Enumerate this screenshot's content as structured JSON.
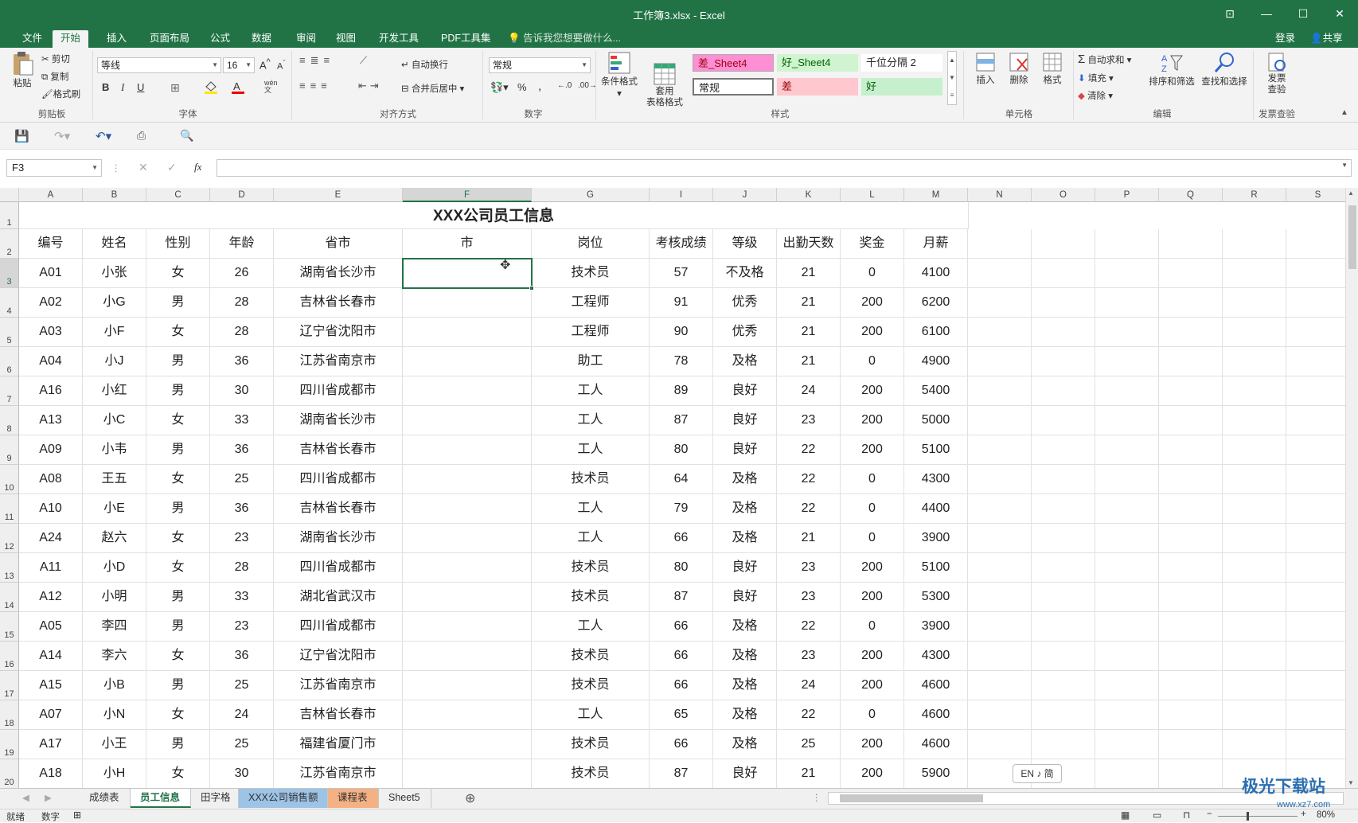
{
  "window": {
    "title": "工作簿3.xlsx - Excel"
  },
  "ribbon_tabs": [
    "文件",
    "开始",
    "插入",
    "页面布局",
    "公式",
    "数据",
    "审阅",
    "视图",
    "开发工具",
    "PDF工具集"
  ],
  "active_tab": "开始",
  "tell_me": "告诉我您想要做什么...",
  "account": {
    "login": "登录",
    "share": "共享"
  },
  "clipboard": {
    "paste": "粘贴",
    "cut": "剪切",
    "copy": "复制",
    "format_painter": "格式刷",
    "label": "剪贴板"
  },
  "font": {
    "name": "等线",
    "size": "16",
    "label": "字体",
    "bold": "B",
    "italic": "I",
    "underline": "U",
    "phonetic": "wén\n文"
  },
  "alignment": {
    "wrap": "自动换行",
    "merge": "合并后居中",
    "label": "对齐方式"
  },
  "number": {
    "format": "常规",
    "label": "数字",
    "percent": "%",
    "comma": ","
  },
  "styles": {
    "conditional": "条件格式",
    "table": "套用\n表格格式",
    "label": "样式",
    "cells": [
      "差_Sheet4",
      "好_Sheet4",
      "千位分隔 2",
      "常规",
      "差",
      "好"
    ],
    "colors": {
      "bad_bg": "#ffc7ce",
      "good_bg": "#c6efce",
      "bad_pink": "#ff8fd5",
      "good_green": "#d0f4d0"
    }
  },
  "cells_group": {
    "insert": "插入",
    "delete": "删除",
    "format": "格式",
    "label": "单元格"
  },
  "editing": {
    "autosum": "自动求和",
    "fill": "填充",
    "clear": "清除",
    "sort": "排序和筛选",
    "find": "查找和选择",
    "label": "编辑"
  },
  "invoice": {
    "check": "发票\n查验",
    "label": "发票查验"
  },
  "namebox": "F3",
  "fx": "fx",
  "columns": [
    "A",
    "B",
    "C",
    "D",
    "E",
    "F",
    "G",
    "I",
    "J",
    "K",
    "L",
    "M",
    "N",
    "O",
    "P",
    "Q",
    "R",
    "S"
  ],
  "row_numbers": [
    "1",
    "2",
    "3",
    "4",
    "5",
    "6",
    "7",
    "8",
    "9",
    "10",
    "11",
    "12",
    "13",
    "14",
    "15",
    "16",
    "17",
    "18",
    "19",
    "20"
  ],
  "sheet_title": "XXX公司员工信息",
  "headers": [
    "编号",
    "姓名",
    "性别",
    "年龄",
    "省市",
    "市",
    "岗位",
    "考核成绩",
    "等级",
    "出勤天数",
    "奖金",
    "月薪"
  ],
  "rows": [
    [
      "A01",
      "小张",
      "女",
      "26",
      "湖南省长沙市",
      "",
      "技术员",
      "57",
      "不及格",
      "21",
      "0",
      "4100"
    ],
    [
      "A02",
      "小G",
      "男",
      "28",
      "吉林省长春市",
      "",
      "工程师",
      "91",
      "优秀",
      "21",
      "200",
      "6200"
    ],
    [
      "A03",
      "小F",
      "女",
      "28",
      "辽宁省沈阳市",
      "",
      "工程师",
      "90",
      "优秀",
      "21",
      "200",
      "6100"
    ],
    [
      "A04",
      "小J",
      "男",
      "36",
      "江苏省南京市",
      "",
      "助工",
      "78",
      "及格",
      "21",
      "0",
      "4900"
    ],
    [
      "A16",
      "小红",
      "男",
      "30",
      "四川省成都市",
      "",
      "工人",
      "89",
      "良好",
      "24",
      "200",
      "5400"
    ],
    [
      "A13",
      "小C",
      "女",
      "33",
      "湖南省长沙市",
      "",
      "工人",
      "87",
      "良好",
      "23",
      "200",
      "5000"
    ],
    [
      "A09",
      "小韦",
      "男",
      "36",
      "吉林省长春市",
      "",
      "工人",
      "80",
      "良好",
      "22",
      "200",
      "5100"
    ],
    [
      "A08",
      "王五",
      "女",
      "25",
      "四川省成都市",
      "",
      "技术员",
      "64",
      "及格",
      "22",
      "0",
      "4300"
    ],
    [
      "A10",
      "小E",
      "男",
      "36",
      "吉林省长春市",
      "",
      "工人",
      "79",
      "及格",
      "22",
      "0",
      "4400"
    ],
    [
      "A24",
      "赵六",
      "女",
      "23",
      "湖南省长沙市",
      "",
      "工人",
      "66",
      "及格",
      "21",
      "0",
      "3900"
    ],
    [
      "A11",
      "小D",
      "女",
      "28",
      "四川省成都市",
      "",
      "技术员",
      "80",
      "良好",
      "23",
      "200",
      "5100"
    ],
    [
      "A12",
      "小明",
      "男",
      "33",
      "湖北省武汉市",
      "",
      "技术员",
      "87",
      "良好",
      "23",
      "200",
      "5300"
    ],
    [
      "A05",
      "李四",
      "男",
      "23",
      "四川省成都市",
      "",
      "工人",
      "66",
      "及格",
      "22",
      "0",
      "3900"
    ],
    [
      "A14",
      "李六",
      "女",
      "36",
      "辽宁省沈阳市",
      "",
      "技术员",
      "66",
      "及格",
      "23",
      "200",
      "4300"
    ],
    [
      "A15",
      "小B",
      "男",
      "25",
      "江苏省南京市",
      "",
      "技术员",
      "66",
      "及格",
      "24",
      "200",
      "4600"
    ],
    [
      "A07",
      "小N",
      "女",
      "24",
      "吉林省长春市",
      "",
      "工人",
      "65",
      "及格",
      "22",
      "0",
      "4600"
    ],
    [
      "A17",
      "小王",
      "男",
      "25",
      "福建省厦门市",
      "",
      "技术员",
      "66",
      "及格",
      "25",
      "200",
      "4600"
    ],
    [
      "A18",
      "小H",
      "女",
      "30",
      "江苏省南京市",
      "",
      "技术员",
      "87",
      "良好",
      "21",
      "200",
      "5900"
    ]
  ],
  "sheet_tabs": [
    {
      "name": "成绩表",
      "color": ""
    },
    {
      "name": "员工信息",
      "color": ""
    },
    {
      "name": "田字格",
      "color": ""
    },
    {
      "name": "XXX公司销售额",
      "color": "#9dc3e6"
    },
    {
      "name": "课程表",
      "color": "#f4b183"
    },
    {
      "name": "Sheet5",
      "color": ""
    }
  ],
  "active_sheet": "员工信息",
  "status": {
    "ready": "就绪",
    "mode": "数字",
    "zoom": "80%"
  },
  "ime": "EN ♪ 简",
  "watermark": {
    "main": "极光下载站",
    "sub": "www.xz7.com"
  },
  "accent": "#217346"
}
